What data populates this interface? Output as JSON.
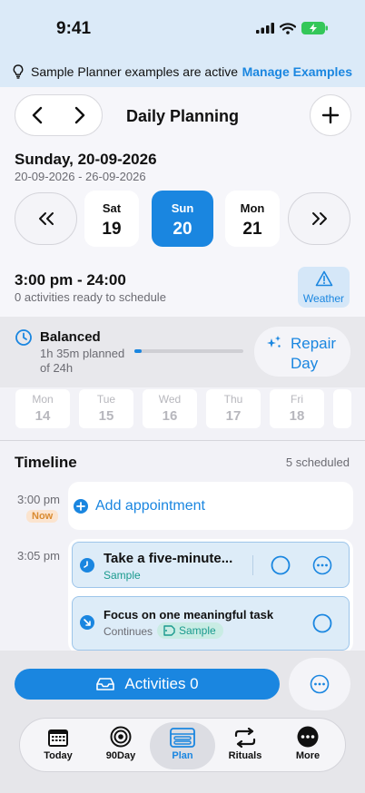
{
  "status": {
    "time": "9:41"
  },
  "banner": {
    "text": "Sample Planner examples are active",
    "link": "Manage Examples"
  },
  "header": {
    "title": "Daily Planning",
    "date_main": "Sunday, 20-09-2026",
    "date_range": "20-09-2026 - 26-09-2026",
    "days": [
      {
        "name": "Sat",
        "num": "19"
      },
      {
        "name": "Sun",
        "num": "20"
      },
      {
        "name": "Mon",
        "num": "21"
      }
    ],
    "slot_time": "3:00 pm - 24:00",
    "slot_sub": "0 activities ready to schedule",
    "weather_label": "Weather"
  },
  "balance": {
    "title": "Balanced",
    "planned": "1h 35m planned",
    "of_total": "of 24h",
    "progress": 0.066,
    "repair_label": "Repair Day"
  },
  "mini_days": [
    {
      "name": "Mon",
      "num": "14"
    },
    {
      "name": "Tue",
      "num": "15"
    },
    {
      "name": "Wed",
      "num": "16"
    },
    {
      "name": "Thu",
      "num": "17"
    },
    {
      "name": "Fri",
      "num": "18"
    }
  ],
  "timeline": {
    "title": "Timeline",
    "count": "5 scheduled",
    "time1": "3:00 pm",
    "now_badge": "Now",
    "add_label": "Add appointment",
    "time2": "3:05 pm",
    "task1": {
      "title": "Take a five-minute...",
      "tag": "Sample"
    },
    "task2": {
      "title": "Focus on one meaningful task",
      "continues": "Continues",
      "tag": "Sample"
    }
  },
  "bottom": {
    "activities_label": "Activities 0"
  },
  "tabs": [
    {
      "label": "Today",
      "icon": "calendar-icon"
    },
    {
      "label": "90Day",
      "icon": "target-icon"
    },
    {
      "label": "Plan",
      "icon": "plan-icon"
    },
    {
      "label": "Rituals",
      "icon": "repeat-icon"
    },
    {
      "label": "More",
      "icon": "more-icon"
    }
  ],
  "colors": {
    "accent": "#1a86e0",
    "now": "#d98a2f",
    "sample": "#1a9a8e"
  }
}
